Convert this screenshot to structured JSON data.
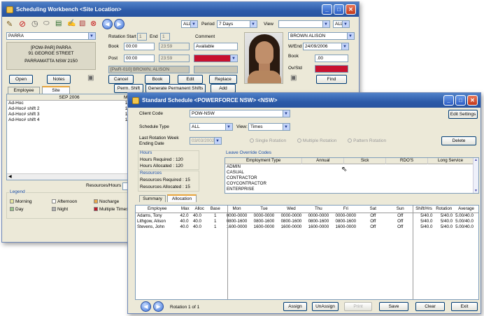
{
  "back_window": {
    "title": "Scheduling Workbench <Site Location>",
    "toolbar": {
      "period_select": "ALL",
      "period_label": "Period",
      "period_value": "7 Days",
      "view_label": "View",
      "view_value": "",
      "view_filter": "ALL"
    },
    "location": {
      "code": "PARRA",
      "name": "[POW-PAR] PARRA",
      "street": "91 GEORGE STREET",
      "suburb": "PARRAMATTA NSW 2150"
    },
    "rotation": {
      "rotation_start_label": "Rotation Start",
      "rotation_start_value": "1",
      "end_label": "End",
      "end_value": "1",
      "book_label": "Book",
      "book_from": "00:00",
      "book_to": "23:59",
      "post_label": "Post",
      "post_from": "00:00",
      "post_to": "23:59",
      "comment_label": "Comment",
      "comment_value": "Available",
      "assigned_employee": "[PwR-010] BROWN, ALISON"
    },
    "employee": {
      "name": "BROWN ALISON",
      "wend_label": "W/End",
      "wend_value": "24/09/2006",
      "book_label": "Book",
      "book_value": ".00",
      "ovstd_label": "Ov/Std"
    },
    "buttons": {
      "open": "Open",
      "notes": "Notes",
      "cancel": "Cancel",
      "book": "Book",
      "edit": "Edit",
      "replace": "Replace",
      "perm_shift": "Perm. Shift",
      "generate": "Generate Permanent Shifts",
      "add": "Add",
      "find": "Find"
    },
    "tabs": [
      "Employee",
      "Site"
    ],
    "grid_header": "SEP 2006",
    "grid_header_right": "Mo",
    "shifts": [
      {
        "name": "Ad-Hoc",
        "val": "10"
      },
      {
        "name": "Ad-Hoc# shift 2",
        "val": "10"
      },
      {
        "name": "Ad-Hoc# shift 3",
        "val": "10"
      },
      {
        "name": "Ad-Hoc# shift 4",
        "val": "10"
      }
    ],
    "resources_label": "Resources/Hours",
    "legend_title": "Legend",
    "legend": [
      {
        "label": "Morning",
        "color": "#e6e6a0"
      },
      {
        "label": "Afternoon",
        "color": "#ffffff"
      },
      {
        "label": "Nocharge",
        "color": "#e8a64a"
      },
      {
        "label": "Day",
        "color": "#9bc68a"
      },
      {
        "label": "Night",
        "color": "#b0b0b0"
      },
      {
        "label": "Multiple Times",
        "color": "#c01828"
      }
    ]
  },
  "front_window": {
    "title": "Standard Schedule <POWERFORCE NSW> <NSW>",
    "client_code_label": "Client Code",
    "client_code_value": "POW-NSW",
    "schedule_type_label": "Schedule Type",
    "schedule_type_value": "ALL",
    "view_label": "View:",
    "view_value": "Times",
    "last_rotation_label_1": "Last Rotation Week",
    "last_rotation_label_2": "Ending Date",
    "last_rotation_value": "03/03/2002",
    "rotation_options": [
      "Single Rotation",
      "Multiple Rotation",
      "Pattern Rotation"
    ],
    "edit_settings": "Edit Settings",
    "delete": "Delete",
    "hours": {
      "title": "Hours",
      "required": "Hours Required : 120",
      "allocated": "Hours Allocated : 120"
    },
    "resources": {
      "title": "Resources",
      "required": "Resources  Required : 15",
      "allocated": "Resources  Allocated : 15"
    },
    "tabs": [
      "Summary",
      "Allocation"
    ],
    "leave": {
      "title": "Leave Override Codes",
      "columns": [
        "Employment Type",
        "Annual",
        "Sick",
        "RDO'S",
        "Long Service"
      ],
      "rows": [
        "ADMIN",
        "CASUAL",
        "CONTRACTOR",
        "COYCONTRACTOR",
        "ENTERPRISE"
      ]
    },
    "schedule": {
      "left_columns": [
        "Employee",
        "Max",
        "Alloc",
        "Base"
      ],
      "day_columns": [
        "Mon",
        "Tue",
        "Wed",
        "Thu",
        "Fri",
        "Sat",
        "Sun"
      ],
      "right_columns": [
        "Shift/Hrs",
        "Rotation",
        "Average"
      ],
      "rows": [
        {
          "employee": "Adams, Tony",
          "max": "42.0",
          "alloc": "40.0",
          "base": "1",
          "days": [
            "0000-0000",
            "0000-0000",
            "0000-0000",
            "0000-0000",
            "0000-0000",
            "Off",
            "Off"
          ],
          "shift": "5/40.0",
          "rotation": "5/40.0",
          "average": "5.00/40.0"
        },
        {
          "employee": "Lithgow, Alison",
          "max": "40.0",
          "alloc": "40.0",
          "base": "1",
          "days": [
            "0800-1600",
            "0800-1600",
            "0800-1600",
            "0800-1600",
            "0800-1600",
            "Off",
            "Off"
          ],
          "shift": "5/40.0",
          "rotation": "5/40.0",
          "average": "5.00/40.0"
        },
        {
          "employee": "Stevens, John",
          "max": "40.0",
          "alloc": "40.0",
          "base": "1",
          "days": [
            "1600-0000",
            "1600-0000",
            "1600-0000",
            "1600-0000",
            "1600-0000",
            "Off",
            "Off"
          ],
          "shift": "5/40.0",
          "rotation": "5/40.0",
          "average": "5.00/40.0"
        }
      ]
    },
    "footer": {
      "rotation_text": "Rotation 1 of 1",
      "assign": "Assign",
      "unassign": "UnAssign",
      "print": "Print",
      "save": "Save",
      "clear": "Clear",
      "exit": "Exit"
    }
  }
}
